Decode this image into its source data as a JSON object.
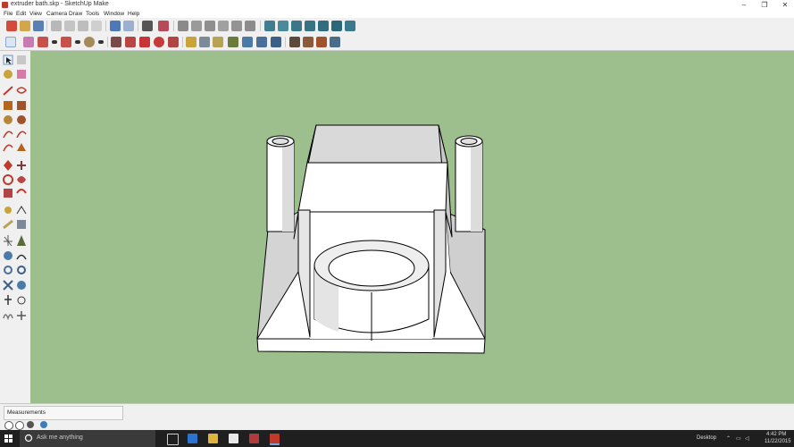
{
  "window": {
    "title": "extruder bath.skp - SketchUp Make",
    "minimize": "–",
    "maximize": "❐",
    "close": "✕"
  },
  "menu": [
    "File",
    "Edit",
    "View",
    "Camera",
    "Draw",
    "Tools",
    "Window",
    "Help"
  ],
  "colors": {
    "viewport": "#9dbf8e",
    "model_face": "#ffffff",
    "model_shade": "#d4d4d4",
    "model_edge": "#000000",
    "taskbar": "#1f1f1f",
    "accent_red": "#c0392b"
  },
  "toolbar_top_icons": [
    "new-icon",
    "open-icon",
    "save-icon",
    "cut-icon",
    "copy-icon",
    "paste-icon",
    "erase-icon",
    "undo-icon",
    "redo-icon",
    "print-icon",
    "model-info-icon",
    "iso-view-icon",
    "top-view-icon",
    "front-view-icon",
    "right-view-icon",
    "back-view-icon",
    "left-view-icon",
    "xray-icon",
    "wireframe-icon",
    "hidden-line-icon",
    "shaded-icon",
    "textured-icon",
    "monochrome-icon"
  ],
  "toolbar_second_icons": [
    "select-icon",
    "make-component-icon",
    "eraser-icon",
    "pencil-line-icon",
    "arc-icon",
    "shape-icon",
    "push-pull-icon",
    "follow-me-icon",
    "move-icon",
    "rotate-icon",
    "scale-icon",
    "offset-icon",
    "tape-measure-icon",
    "text-icon",
    "axes-icon",
    "3d-text-icon",
    "paint-bucket-icon",
    "orbit-icon",
    "pan-icon",
    "zoom-icon",
    "zoom-extents-icon",
    "warehouse-icon",
    "extension-icon",
    "share-icon",
    "layout-icon"
  ],
  "statusbar": {
    "measurements_label": "Measurements"
  },
  "taskbar": {
    "search_placeholder": "Ask me anything",
    "desktop_label": "Desktop",
    "time": "4:42 PM",
    "date": "11/22/2015"
  }
}
